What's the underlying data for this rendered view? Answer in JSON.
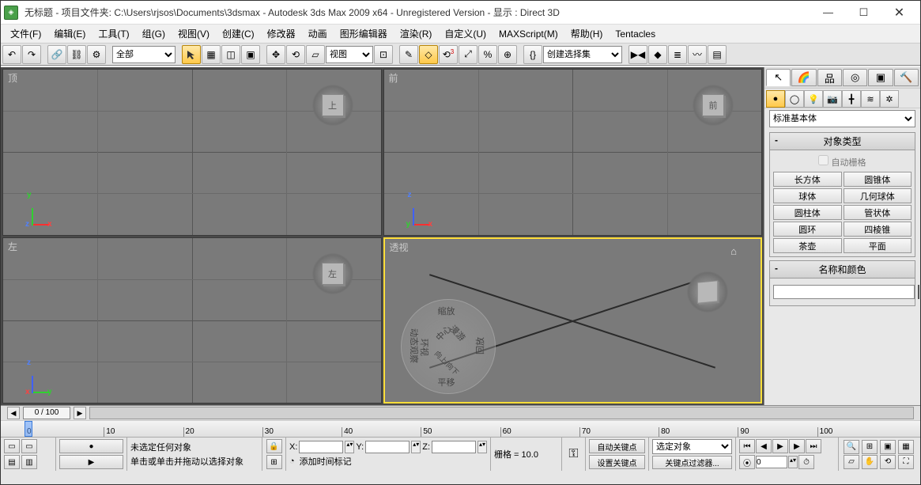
{
  "title": "无标题   - 项目文件夹: C:\\Users\\rjsos\\Documents\\3dsmax      - Autodesk 3ds Max  2009 x64  - Unregistered Version     - 显示 : Direct 3D",
  "menu": [
    "文件(F)",
    "编辑(E)",
    "工具(T)",
    "组(G)",
    "视图(V)",
    "创建(C)",
    "修改器",
    "动画",
    "图形编辑器",
    "渲染(R)",
    "自定义(U)",
    "MAXScript(M)",
    "帮助(H)",
    "Tentacles"
  ],
  "toolbar": {
    "filter_label": "全部",
    "ref_label": "视图",
    "namedset_label": "创建选择集"
  },
  "viewports": {
    "top": "顶",
    "front": "前",
    "left": "左",
    "persp": "透视",
    "cube_top": "上",
    "cube_front": "前",
    "cube_left": "左"
  },
  "wheel": {
    "zoom": "缩放",
    "center": "中心",
    "rewind": "环视",
    "pan": "平移",
    "orbit": "动态观察",
    "look": "漫游",
    "updown": "向上/向下",
    "walk": "回放"
  },
  "cmdpanel": {
    "dropdown": "标准基本体",
    "roll_obj": "对象类型",
    "autogrid": "自动栅格",
    "buttons": [
      [
        "长方体",
        "圆锥体"
      ],
      [
        "球体",
        "几何球体"
      ],
      [
        "圆柱体",
        "管状体"
      ],
      [
        "圆环",
        "四棱锥"
      ],
      [
        "茶壶",
        "平面"
      ]
    ],
    "roll_name": "名称和颜色"
  },
  "time": {
    "slider": "0 / 100",
    "ticks": [
      "0",
      "10",
      "20",
      "30",
      "40",
      "50",
      "60",
      "70",
      "80",
      "90",
      "100"
    ]
  },
  "status": {
    "prompt1": "未选定任何对象",
    "prompt2": "单击或单击并拖动以选择对象",
    "x": "X:",
    "y": "Y:",
    "z": "Z:",
    "grid": "栅格 = 10.0",
    "add_time": "添加时间标记",
    "autokey": "自动关键点",
    "setkey": "设置关键点",
    "sel_label": "选定对象",
    "keyfilter": "关键点过滤器..."
  }
}
